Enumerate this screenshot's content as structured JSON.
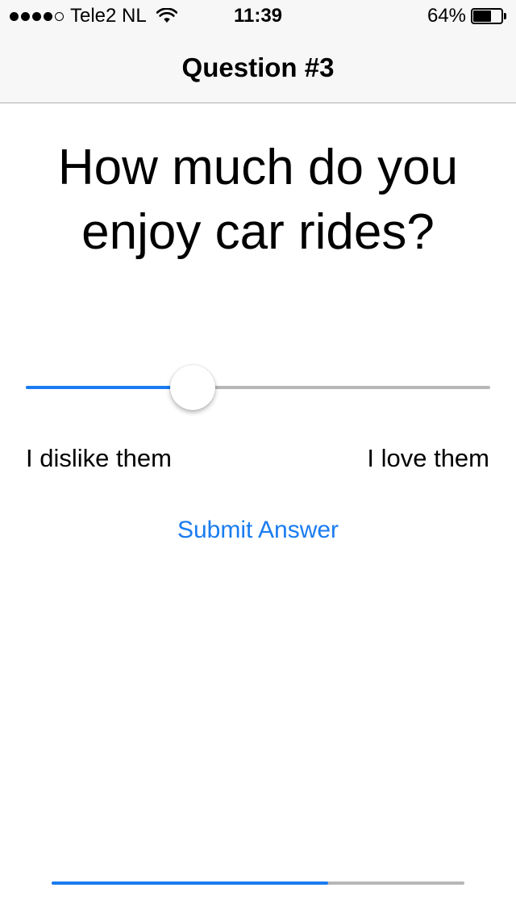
{
  "status_bar": {
    "carrier": "Tele2 NL",
    "signal_bars_filled": 4,
    "signal_bars_total": 5,
    "wifi_icon": "wifi-icon",
    "time": "11:39",
    "battery_percent_label": "64%",
    "battery_level": 0.64
  },
  "nav": {
    "title": "Question #3"
  },
  "question": {
    "text": "How much do you enjoy car rides?"
  },
  "slider": {
    "value": 0.36,
    "min_label": "I dislike them",
    "max_label": "I love them"
  },
  "submit": {
    "label": "Submit Answer"
  },
  "progress": {
    "value": 0.67
  },
  "colors": {
    "accent": "#1a7cf0",
    "track": "#b7b7b7",
    "bar_background": "#f7f7f7"
  }
}
